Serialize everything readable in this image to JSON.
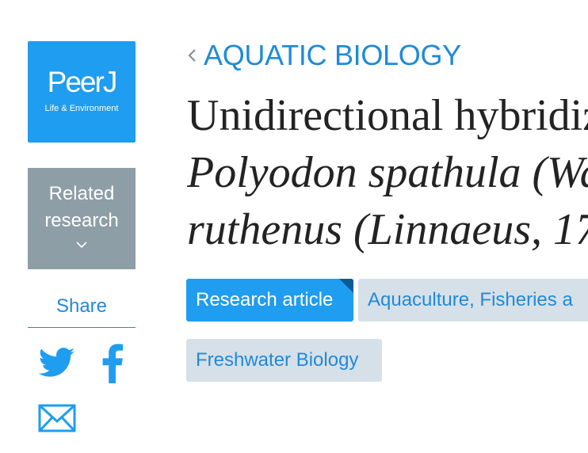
{
  "logo": {
    "brand": "PeerJ",
    "subtitle": "Life & Environment"
  },
  "related": {
    "line1": "Related",
    "line2": "research",
    "chevron_icon": "chevron-down-icon"
  },
  "share": {
    "label": "Share",
    "buttons": [
      "twitter-icon",
      "facebook-icon",
      "email-icon"
    ]
  },
  "breadcrumb": {
    "label": "AQUATIC BIOLOGY",
    "icon": "chevron-left-icon"
  },
  "article": {
    "title_line1": "Unidirectional hybridiz",
    "title_line2": "Polyodon spathula (Wa",
    "title_line3": "ruthenus (Linnaeus, 17"
  },
  "tags": {
    "type": "Research article",
    "subjects": [
      "Aquaculture, Fisheries a",
      "Freshwater Biology"
    ]
  },
  "colors": {
    "brand_blue": "#1f9df0",
    "link_blue": "#1f8ad9",
    "related_gray": "#8e9ea7",
    "tag_bg": "#d6e0e8",
    "title_text": "#232323"
  }
}
